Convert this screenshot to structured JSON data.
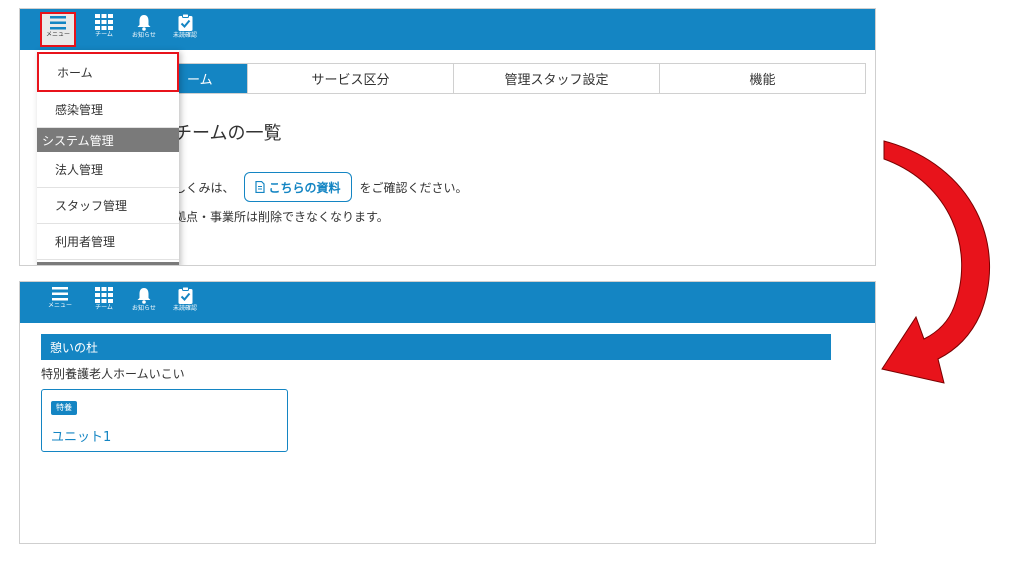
{
  "toolbar": {
    "menu_label": "メニュー",
    "team_label": "チーム",
    "notify_label": "お知らせ",
    "unconfirmed_label": "未読確認"
  },
  "tabs": [
    "ーム",
    "サービス区分",
    "管理スタッフ設定",
    "機能"
  ],
  "content": {
    "heading": "チームの一覧",
    "line1_prefix": "しくみは、",
    "doc_button": "こちらの資料",
    "line1_suffix": "をご確認ください。",
    "line2": "拠点・事業所は削除できなくなります。"
  },
  "dropdown": {
    "home": "ホーム",
    "infection": "感染管理",
    "section_system": "システム管理",
    "corp": "法人管理",
    "staff": "スタッフ管理",
    "users": "利用者管理"
  },
  "unit": {
    "header": "憩いの杜",
    "facility": "特別養護老人ホームいこい",
    "badge": "特養",
    "unit_name": "ユニット1"
  },
  "colors": {
    "primary": "#1485c3",
    "highlight": "#e8131b",
    "section": "#7a7a7a"
  }
}
